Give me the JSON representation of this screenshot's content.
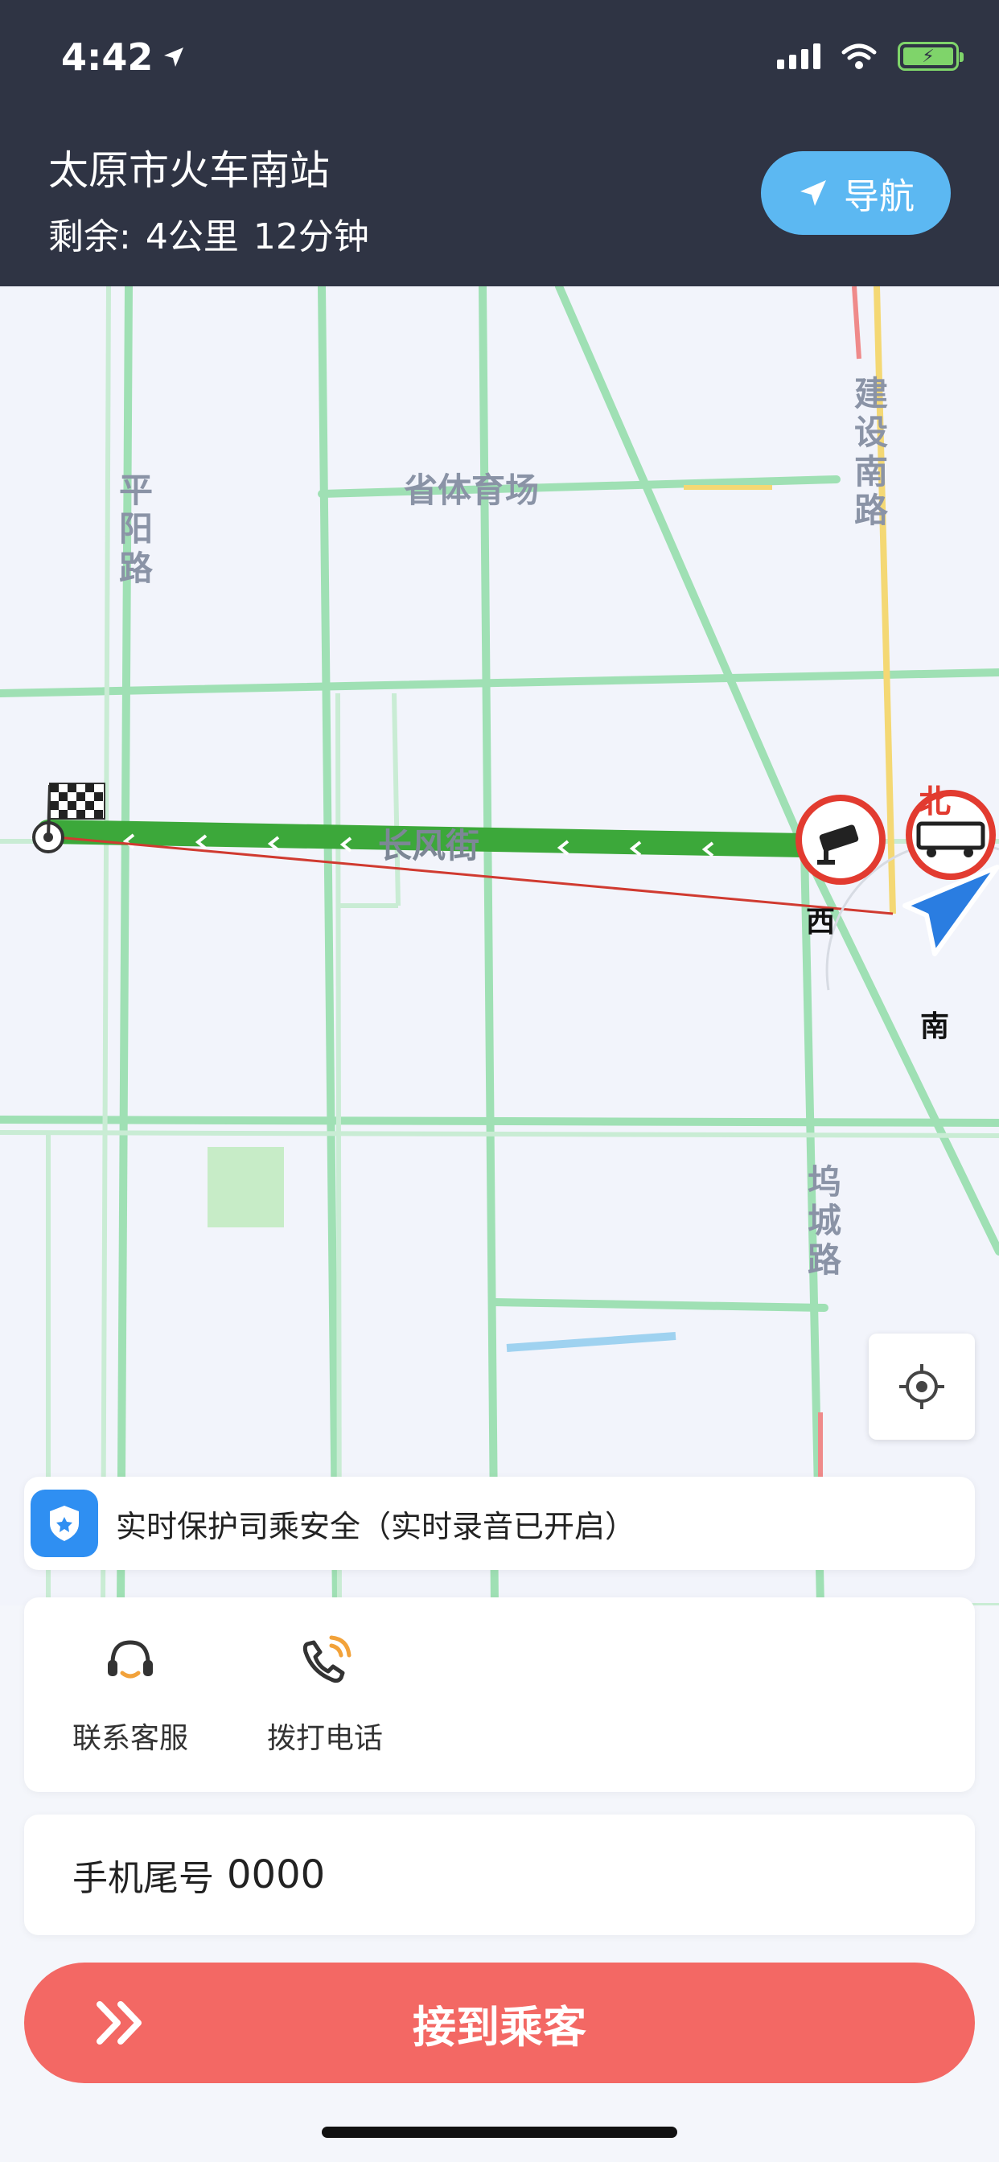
{
  "status_bar": {
    "time": "4:42"
  },
  "header": {
    "destination": "太原市火车南站",
    "remaining_label": "剩余:",
    "distance": "4公里",
    "duration": "12分钟",
    "nav_button": "导航"
  },
  "map": {
    "labels": {
      "pingyang_road": "平阳路",
      "stadium": "省体育场",
      "jianshe_south_road": "建设南路",
      "changfeng_street": "长风街",
      "wucheng_road": "坞城路",
      "west": "西",
      "south": "南",
      "north": "北"
    }
  },
  "safety": {
    "text": "实时保护司乘安全（实时录音已开启）"
  },
  "actions": {
    "customer_service": "联系客服",
    "call": "拨打电话"
  },
  "phone": {
    "label": "手机尾号",
    "number": "0000"
  },
  "pickup_button": "接到乘客",
  "colors": {
    "header_bg": "#2f3444",
    "accent_blue": "#5cb8f2",
    "route_green": "#3ca83a",
    "primary_red": "#f36864"
  }
}
